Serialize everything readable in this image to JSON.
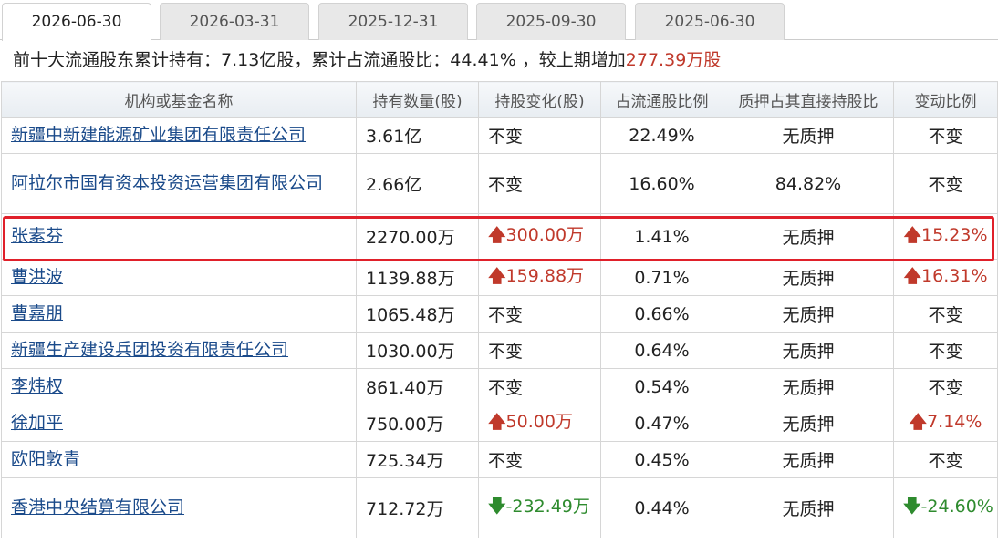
{
  "tabs": [
    "2026-06-30",
    "2026-03-31",
    "2025-12-31",
    "2025-09-30",
    "2025-06-30"
  ],
  "summary": {
    "prefix": "前十大流通股东累计持有：7.13亿股，累计占流通股比：44.41% ，较上期增加",
    "change": "277.39万股"
  },
  "headers": [
    "机构或基金名称",
    "持有数量(股)",
    "持股变化(股)",
    "占流通股比例",
    "质押占其直接持股比",
    "变动比例"
  ],
  "rows": [
    {
      "name": "新疆中新建能源矿业集团有限责任公司",
      "qty": "3.61亿",
      "change": "不变",
      "change_dir": "none",
      "ratio": "22.49%",
      "pledge": "无质押",
      "pct": "不变",
      "pct_dir": "none"
    },
    {
      "name": "阿拉尔市国有资本投资运营集团有限公司",
      "qty": "2.66亿",
      "change": "不变",
      "change_dir": "none",
      "ratio": "16.60%",
      "pledge": "84.82%",
      "pct": "不变",
      "pct_dir": "none"
    },
    {
      "name": "张素芬",
      "qty": "2270.00万",
      "change": "300.00万",
      "change_dir": "up",
      "ratio": "1.41%",
      "pledge": "无质押",
      "pct": "15.23%",
      "pct_dir": "up"
    },
    {
      "name": "曹洪波",
      "qty": "1139.88万",
      "change": "159.88万",
      "change_dir": "up",
      "ratio": "0.71%",
      "pledge": "无质押",
      "pct": "16.31%",
      "pct_dir": "up"
    },
    {
      "name": "曹嘉朋",
      "qty": "1065.48万",
      "change": "不变",
      "change_dir": "none",
      "ratio": "0.66%",
      "pledge": "无质押",
      "pct": "不变",
      "pct_dir": "none"
    },
    {
      "name": "新疆生产建设兵团投资有限责任公司",
      "qty": "1030.00万",
      "change": "不变",
      "change_dir": "none",
      "ratio": "0.64%",
      "pledge": "无质押",
      "pct": "不变",
      "pct_dir": "none"
    },
    {
      "name": "李炜权",
      "qty": "861.40万",
      "change": "不变",
      "change_dir": "none",
      "ratio": "0.54%",
      "pledge": "无质押",
      "pct": "不变",
      "pct_dir": "none"
    },
    {
      "name": "徐加平",
      "qty": "750.00万",
      "change": "50.00万",
      "change_dir": "up",
      "ratio": "0.47%",
      "pledge": "无质押",
      "pct": "7.14%",
      "pct_dir": "up"
    },
    {
      "name": "欧阳敦青",
      "qty": "725.34万",
      "change": "不变",
      "change_dir": "none",
      "ratio": "0.45%",
      "pledge": "无质押",
      "pct": "不变",
      "pct_dir": "none"
    },
    {
      "name": "香港中央结算有限公司",
      "qty": "712.72万",
      "change": "-232.49万",
      "change_dir": "down",
      "ratio": "0.44%",
      "pledge": "无质押",
      "pct": "-24.60%",
      "pct_dir": "down"
    }
  ],
  "colors": {
    "up": "#c0392b",
    "down": "#2e8b2e",
    "link": "#1a4a8a",
    "highlight": "#e0202a"
  },
  "icons": {
    "up": "arrow-up-icon",
    "down": "arrow-down-icon"
  }
}
